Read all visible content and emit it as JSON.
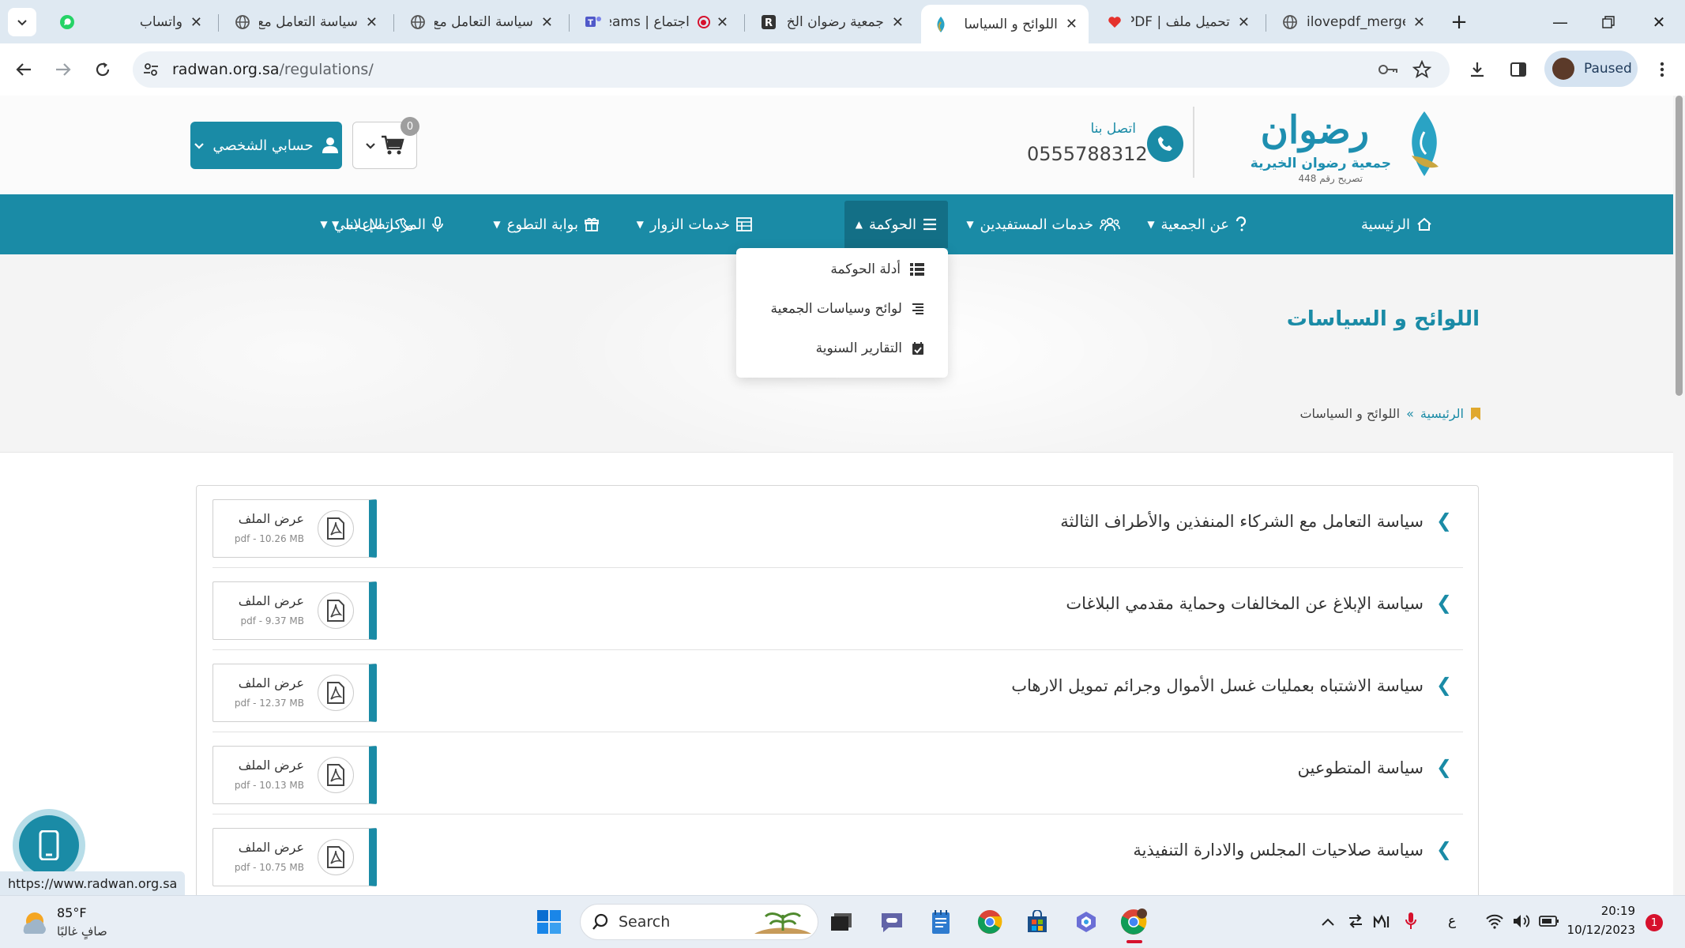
{
  "browser": {
    "tabs": [
      {
        "title": "واتساب",
        "icon": "whatsapp-icon",
        "active": false
      },
      {
        "title": "سياسة التعامل مع",
        "icon": "globe-icon",
        "active": false
      },
      {
        "title": "سياسة التعامل مع",
        "icon": "globe-icon",
        "active": false
      },
      {
        "title": "اجتماع | eams",
        "icon": "teams-icon",
        "active": false
      },
      {
        "title": "جمعية رضوان الخ",
        "icon": "r-logo-icon",
        "active": false
      },
      {
        "title": "اللوائح و السياسا",
        "icon": "radwan-favicon",
        "active": true
      },
      {
        "title": "تحميل ملف | PDF",
        "icon": "ilovepdf-heart-icon",
        "active": false
      },
      {
        "title": "ilovepdf_merged",
        "icon": "globe-icon",
        "active": false
      }
    ],
    "url_domain": "radwan.org.sa",
    "url_path": "/regulations/",
    "profile_label": "Paused",
    "status_url": "https://www.radwan.org.sa"
  },
  "header": {
    "logo_name": "رضوان",
    "logo_sub": "جمعية رضوان الخيرية",
    "logo_license": "تصريح رقم 448",
    "contact_label": "اتصل بنا",
    "contact_phone": "0555788312",
    "cart_count": "0",
    "account_label": "حسابي الشخصي"
  },
  "nav": {
    "items": [
      {
        "label": "الرئيسية",
        "icon": "home-icon"
      },
      {
        "label": "عن الجمعية",
        "icon": "question-icon"
      },
      {
        "label": "خدمات المستفيدين",
        "icon": "users-icon"
      },
      {
        "label": "الحوكمة",
        "icon": "list-icon"
      },
      {
        "label": "خدمات الزوار",
        "icon": "table-icon"
      },
      {
        "label": "بوابة التطوع",
        "icon": "gift-icon"
      },
      {
        "label": "المركز الإعلامي",
        "icon": "microphone-icon"
      },
      {
        "label": "اتصل بنا",
        "icon": "phone-icon"
      }
    ],
    "dropdown": [
      {
        "label": "أدلة الحوكمة",
        "icon": "th-list-icon"
      },
      {
        "label": "لوائح وسياسات الجمعية",
        "icon": "align-right-icon"
      },
      {
        "label": "التقارير السنوية",
        "icon": "calendar-check-icon"
      }
    ]
  },
  "hero": {
    "title": "اللوائح و السياسات",
    "breadcrumb_home": "الرئيسية",
    "breadcrumb_sep": "»",
    "breadcrumb_current": "اللوائح و السياسات"
  },
  "documents": [
    {
      "title": "سياسة التعامل مع الشركاء المنفذين والأطراف الثالثة",
      "file_label": "عرض الملف",
      "file_size": "pdf - 10.26 MB"
    },
    {
      "title": "سياسة الإبلاغ عن المخالفات وحماية مقدمي البلاغات",
      "file_label": "عرض الملف",
      "file_size": "pdf - 9.37 MB"
    },
    {
      "title": "سياسة الاشتباه بعمليات غسل الأموال وجرائم تمويل الارهاب",
      "file_label": "عرض الملف",
      "file_size": "pdf - 12.37 MB"
    },
    {
      "title": "سياسة المتطوعين",
      "file_label": "عرض الملف",
      "file_size": "pdf - 10.13 MB"
    },
    {
      "title": "سياسة صلاحيات المجلس والادارة التنفيذية",
      "file_label": "عرض الملف",
      "file_size": "pdf - 10.75 MB"
    }
  ],
  "taskbar": {
    "temperature": "85°F",
    "weather_desc": "صافٍ غالبًا",
    "search_placeholder": "Search",
    "lang": "ع",
    "time": "20:19",
    "date": "10/12/2023",
    "notifications": "1"
  },
  "colors": {
    "brand": "#1a8ba6",
    "brand_dark": "#136f86"
  }
}
